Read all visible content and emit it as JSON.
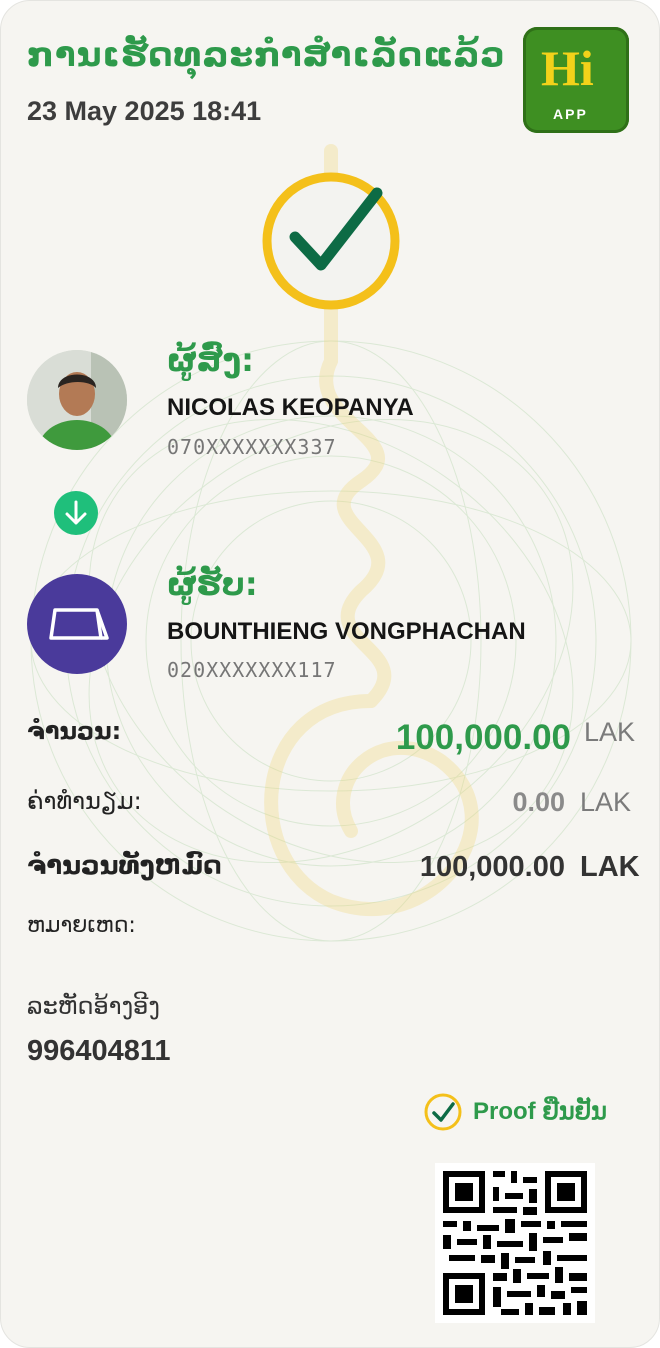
{
  "header": {
    "title": "ການເຮັດທຸລະກຳສຳເລັດແລ້ວ",
    "datetime": "23 May 2025 18:41",
    "logo_text": "Hi",
    "logo_subtext": "APP"
  },
  "sender": {
    "label": "ຜູ້ສົ່ງ:",
    "name": "NICOLAS KEOPANYA",
    "account": "070XXXXXXX337"
  },
  "receiver": {
    "label": "ຜູ້ຮັບ:",
    "name": "BOUNTHIENG VONGPHACHAN",
    "account": "020XXXXXXX117"
  },
  "amounts": {
    "amount_label": "ຈຳນວນ:",
    "amount_value": "100,000.00",
    "fee_label": "ຄ່າທຳນຽມ:",
    "fee_value": "0.00",
    "total_label": "ຈຳນວນທັງຫມົດ",
    "total_value": "100,000.00",
    "currency": "LAK"
  },
  "note": {
    "label": "ຫມາຍເຫດ:"
  },
  "reference": {
    "label": "ລະຫັດອ້າງອີງ",
    "value": "996404811"
  },
  "proof": {
    "label": "Proof ຢືນຢັນ"
  },
  "icons": {
    "success": "check-circle-icon",
    "transfer_direction": "arrow-down-circle-icon",
    "receiver_avatar": "card-icon",
    "proof": "check-circle-small-icon",
    "qr": "qr-code"
  },
  "colors": {
    "brand_green": "#2e9a4b",
    "accent_gold": "#f4c01a",
    "check_green": "#0d6b45",
    "receiver_purple": "#4a3a9b",
    "arrow_teal": "#1fbf7b",
    "background": "#f6f5f1"
  }
}
